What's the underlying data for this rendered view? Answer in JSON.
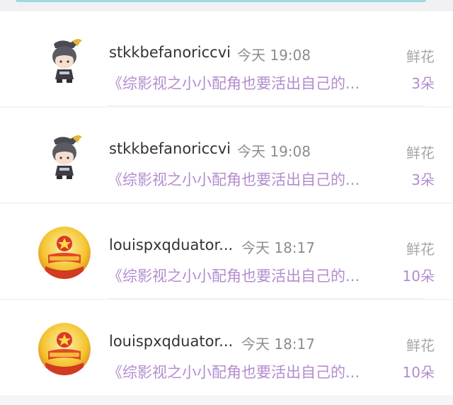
{
  "colors": {
    "username": "#333333",
    "time": "#8d8d8d",
    "gift_type": "#a6a6a6",
    "accent_purple": "#b38ccf",
    "top_accent": "#9fd9e0"
  },
  "gifts": [
    {
      "avatar": "chibi-ninja-avatar",
      "username": "stkkbefanoriccvi",
      "time": "今天 19:08",
      "gift_type": "鲜花",
      "book_title": "《综影视之小小配角也要活出自己的...",
      "count": "3朵"
    },
    {
      "avatar": "chibi-ninja-avatar",
      "username": "stkkbefanoriccvi",
      "time": "今天 19:08",
      "gift_type": "鲜花",
      "book_title": "《综影视之小小配角也要活出自己的...",
      "count": "3朵"
    },
    {
      "avatar": "emblem-avatar",
      "username": "louispxqduator...",
      "time": "今天 18:17",
      "gift_type": "鲜花",
      "book_title": "《综影视之小小配角也要活出自己的...",
      "count": "10朵"
    },
    {
      "avatar": "emblem-avatar",
      "username": "louispxqduator...",
      "time": "今天 18:17",
      "gift_type": "鲜花",
      "book_title": "《综影视之小小配角也要活出自己的...",
      "count": "10朵"
    }
  ]
}
